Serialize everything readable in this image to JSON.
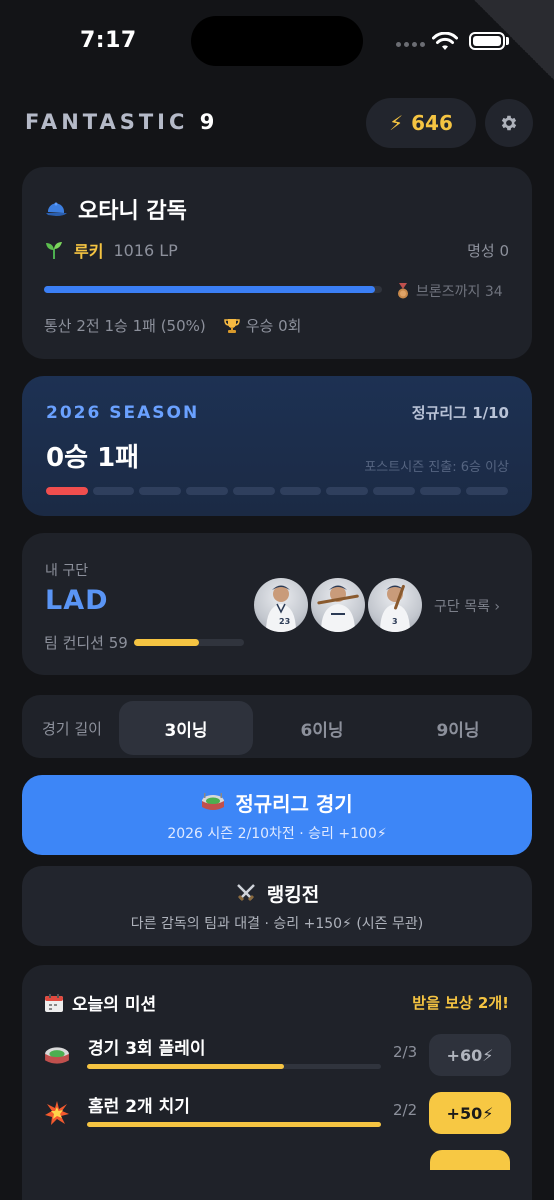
{
  "status_bar": {
    "time": "7:17"
  },
  "header": {
    "title_main": "FANTASTIC",
    "title_num": "9",
    "points": "646",
    "points_icon": "lightning-icon",
    "settings_icon": "gear-icon"
  },
  "manager": {
    "name": "오타니 감독",
    "rank": "루키",
    "lp": "1016 LP",
    "fame": "명성 0",
    "lp_progress": 0.98,
    "next_tier": "브론즈까지 34",
    "record": "통산 2전 1승 1패 (50%)",
    "championships": "우승 0회"
  },
  "season": {
    "label": "2026 SEASON",
    "round": "정규리그 1/10",
    "record": "0승 1패",
    "postseason_req": "포스트시즌 진출: 6승 이상",
    "games": [
      "L",
      "",
      "",
      "",
      "",
      "",
      "",
      "",
      "",
      ""
    ]
  },
  "team": {
    "caption": "내 구단",
    "abbr": "LAD",
    "condition_label": "팀 컨디션 59",
    "condition_value": 59,
    "roster_link": "구단 목록 ›",
    "player_numbers": [
      "23",
      "",
      "3"
    ]
  },
  "game_length": {
    "label": "경기 길이",
    "options": [
      "3이닝",
      "6이닝",
      "9이닝"
    ],
    "selected": "3이닝"
  },
  "league_button": {
    "title": "정규리그 경기",
    "subtitle": "2026 시즌 2/10차전 · 승리 +100⚡"
  },
  "ranked_button": {
    "title": "랭킹전",
    "subtitle": "다른 감독의 팀과 대결 · 승리 +150⚡  (시즌 무관)"
  },
  "missions": {
    "title": "오늘의 미션",
    "reward_status": "받을 보상 2개!",
    "items": [
      {
        "name": "경기 3회 플레이",
        "count": "2/3",
        "reward": "+60⚡",
        "progress": 0.67,
        "claimable": false
      },
      {
        "name": "홈런 2개 치기",
        "count": "2/2",
        "reward": "+50⚡",
        "progress": 1.0,
        "claimable": true
      }
    ]
  },
  "colors": {
    "background": "#131417",
    "card": "#1f2229",
    "accent_blue": "#3d86f7",
    "accent_yellow": "#f5c442",
    "loss_red": "#f04e4e"
  }
}
